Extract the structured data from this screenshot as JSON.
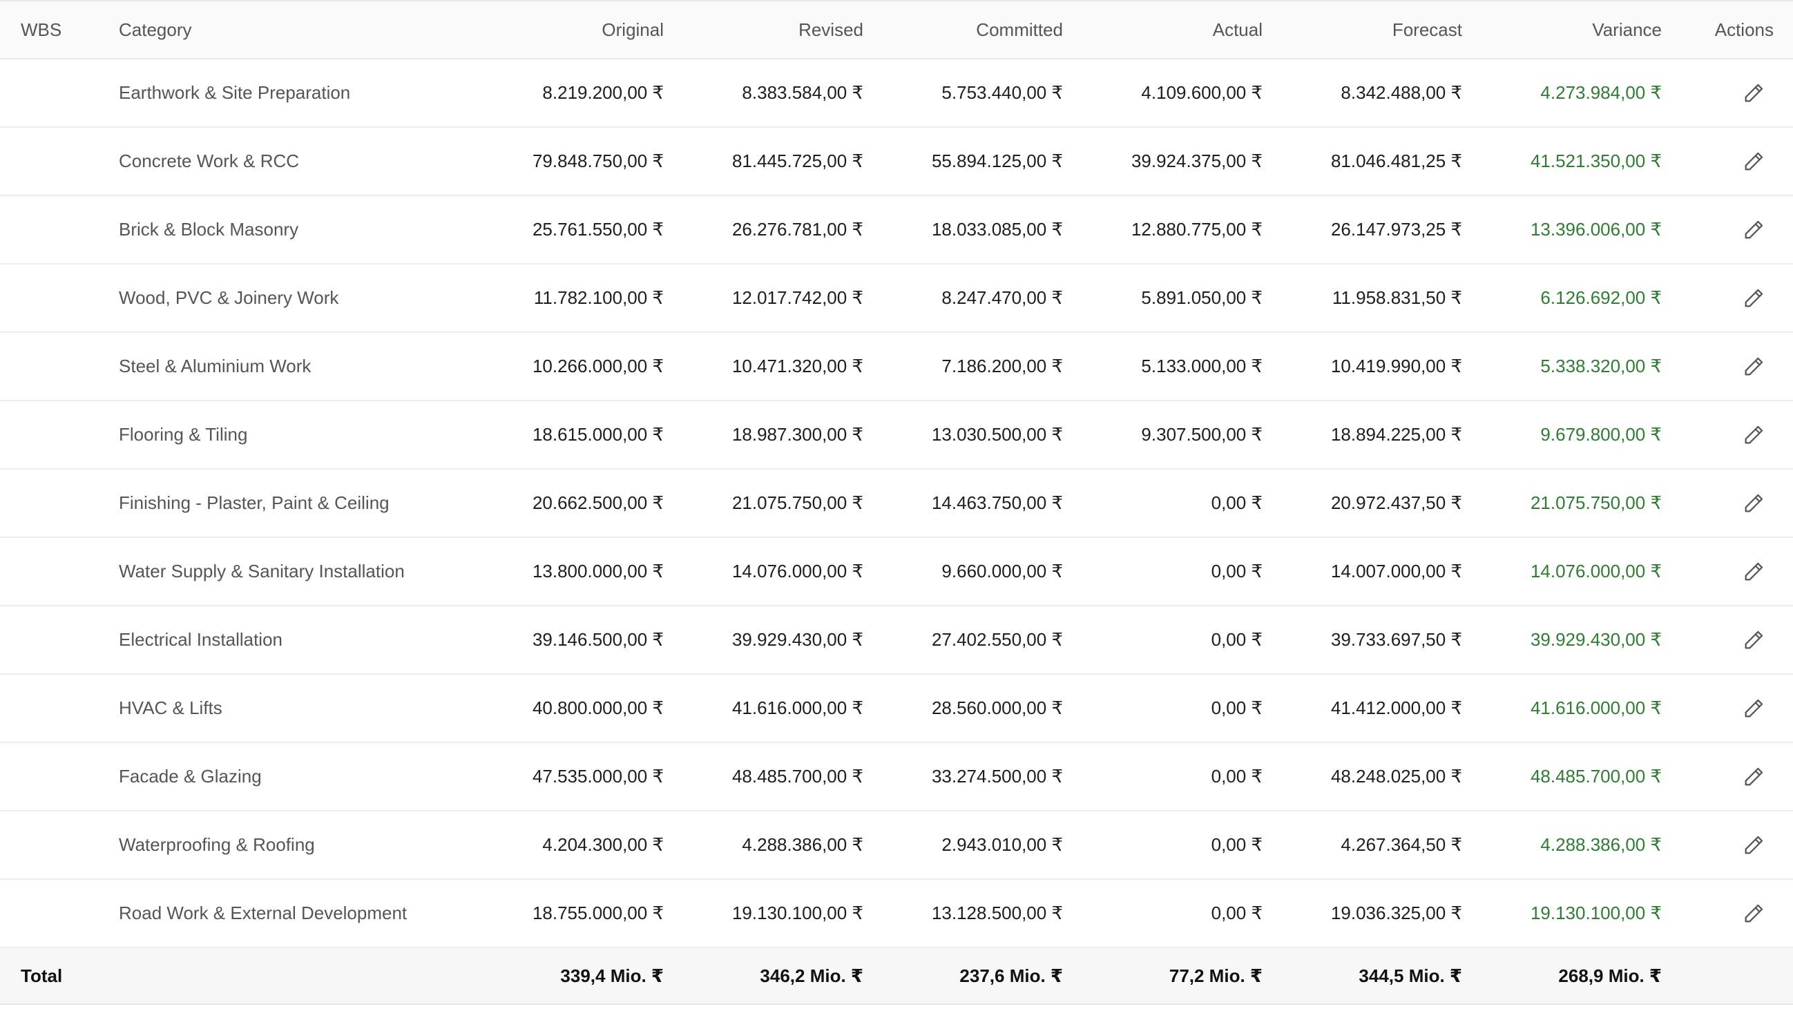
{
  "columns": {
    "wbs": "WBS",
    "category": "Category",
    "original": "Original",
    "revised": "Revised",
    "committed": "Committed",
    "actual": "Actual",
    "forecast": "Forecast",
    "variance": "Variance",
    "actions": "Actions"
  },
  "rows": [
    {
      "wbs": "",
      "category": "Earthwork & Site Preparation",
      "original": "8.219.200,00 ₹",
      "revised": "8.383.584,00 ₹",
      "committed": "5.753.440,00 ₹",
      "actual": "4.109.600,00 ₹",
      "forecast": "8.342.488,00 ₹",
      "variance": "4.273.984,00 ₹"
    },
    {
      "wbs": "",
      "category": "Concrete Work & RCC",
      "original": "79.848.750,00 ₹",
      "revised": "81.445.725,00 ₹",
      "committed": "55.894.125,00 ₹",
      "actual": "39.924.375,00 ₹",
      "forecast": "81.046.481,25 ₹",
      "variance": "41.521.350,00 ₹"
    },
    {
      "wbs": "",
      "category": "Brick & Block Masonry",
      "original": "25.761.550,00 ₹",
      "revised": "26.276.781,00 ₹",
      "committed": "18.033.085,00 ₹",
      "actual": "12.880.775,00 ₹",
      "forecast": "26.147.973,25 ₹",
      "variance": "13.396.006,00 ₹"
    },
    {
      "wbs": "",
      "category": "Wood, PVC & Joinery Work",
      "original": "11.782.100,00 ₹",
      "revised": "12.017.742,00 ₹",
      "committed": "8.247.470,00 ₹",
      "actual": "5.891.050,00 ₹",
      "forecast": "11.958.831,50 ₹",
      "variance": "6.126.692,00 ₹"
    },
    {
      "wbs": "",
      "category": "Steel & Aluminium Work",
      "original": "10.266.000,00 ₹",
      "revised": "10.471.320,00 ₹",
      "committed": "7.186.200,00 ₹",
      "actual": "5.133.000,00 ₹",
      "forecast": "10.419.990,00 ₹",
      "variance": "5.338.320,00 ₹"
    },
    {
      "wbs": "",
      "category": "Flooring & Tiling",
      "original": "18.615.000,00 ₹",
      "revised": "18.987.300,00 ₹",
      "committed": "13.030.500,00 ₹",
      "actual": "9.307.500,00 ₹",
      "forecast": "18.894.225,00 ₹",
      "variance": "9.679.800,00 ₹"
    },
    {
      "wbs": "",
      "category": "Finishing - Plaster, Paint & Ceiling",
      "original": "20.662.500,00 ₹",
      "revised": "21.075.750,00 ₹",
      "committed": "14.463.750,00 ₹",
      "actual": "0,00 ₹",
      "forecast": "20.972.437,50 ₹",
      "variance": "21.075.750,00 ₹"
    },
    {
      "wbs": "",
      "category": "Water Supply & Sanitary Installation",
      "original": "13.800.000,00 ₹",
      "revised": "14.076.000,00 ₹",
      "committed": "9.660.000,00 ₹",
      "actual": "0,00 ₹",
      "forecast": "14.007.000,00 ₹",
      "variance": "14.076.000,00 ₹"
    },
    {
      "wbs": "",
      "category": "Electrical Installation",
      "original": "39.146.500,00 ₹",
      "revised": "39.929.430,00 ₹",
      "committed": "27.402.550,00 ₹",
      "actual": "0,00 ₹",
      "forecast": "39.733.697,50 ₹",
      "variance": "39.929.430,00 ₹"
    },
    {
      "wbs": "",
      "category": "HVAC & Lifts",
      "original": "40.800.000,00 ₹",
      "revised": "41.616.000,00 ₹",
      "committed": "28.560.000,00 ₹",
      "actual": "0,00 ₹",
      "forecast": "41.412.000,00 ₹",
      "variance": "41.616.000,00 ₹"
    },
    {
      "wbs": "",
      "category": "Facade & Glazing",
      "original": "47.535.000,00 ₹",
      "revised": "48.485.700,00 ₹",
      "committed": "33.274.500,00 ₹",
      "actual": "0,00 ₹",
      "forecast": "48.248.025,00 ₹",
      "variance": "48.485.700,00 ₹"
    },
    {
      "wbs": "",
      "category": "Waterproofing & Roofing",
      "original": "4.204.300,00 ₹",
      "revised": "4.288.386,00 ₹",
      "committed": "2.943.010,00 ₹",
      "actual": "0,00 ₹",
      "forecast": "4.267.364,50 ₹",
      "variance": "4.288.386,00 ₹"
    },
    {
      "wbs": "",
      "category": "Road Work & External Development",
      "original": "18.755.000,00 ₹",
      "revised": "19.130.100,00 ₹",
      "committed": "13.128.500,00 ₹",
      "actual": "0,00 ₹",
      "forecast": "19.036.325,00 ₹",
      "variance": "19.130.100,00 ₹"
    }
  ],
  "totals": {
    "label": "Total",
    "original": "339,4 Mio. ₹",
    "revised": "346,2 Mio. ₹",
    "committed": "237,6 Mio. ₹",
    "actual": "77,2 Mio. ₹",
    "forecast": "344,5 Mio. ₹",
    "variance": "268,9 Mio. ₹"
  },
  "icons": {
    "edit": "pencil-icon"
  },
  "colors": {
    "variance_positive": "#2e7d32",
    "header_background": "#fafafa",
    "total_background": "#f7f7f7"
  }
}
